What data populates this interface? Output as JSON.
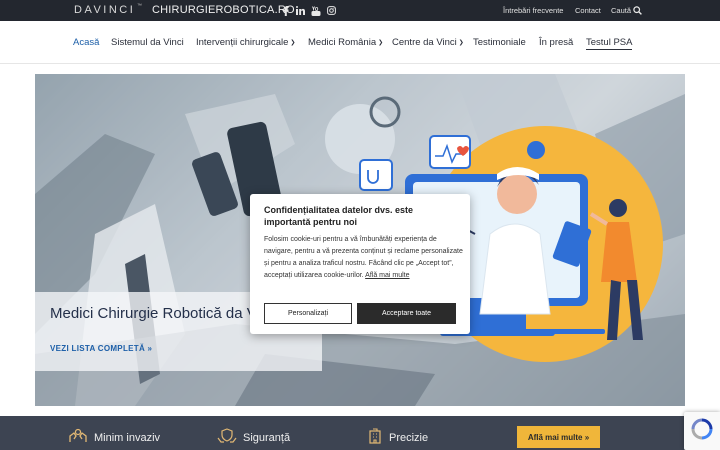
{
  "topbar": {
    "logo": "DAVINCI",
    "logo_tm": "™",
    "site_name": "CHIRURGIEROBOTICA.RO",
    "social_icons": [
      "facebook-icon",
      "linkedin-icon",
      "youtube-icon",
      "instagram-icon"
    ],
    "links": {
      "faq": "Întrebări frecvente",
      "contact": "Contact",
      "search": "Caută"
    }
  },
  "nav": {
    "items": [
      {
        "label": "Acasă",
        "active": true,
        "dropdown": false
      },
      {
        "label": "Sistemul da Vinci",
        "dropdown": false
      },
      {
        "label": "Intervenții chirurgicale",
        "dropdown": true
      },
      {
        "label": "Medici România",
        "dropdown": true
      },
      {
        "label": "Centre da Vinci",
        "dropdown": true
      },
      {
        "label": "Testimoniale",
        "dropdown": false
      },
      {
        "label": "În presă",
        "dropdown": false
      },
      {
        "label": "Testul PSA",
        "dropdown": false,
        "outlined": true
      }
    ]
  },
  "hero": {
    "title": "Medici Chirurgie Robotică da Vinci România",
    "link": "VEZI LISTA COMPLETĂ »"
  },
  "cookie": {
    "title": "Confidențialitatea datelor dvs. este importantă pentru noi",
    "text": "Folosim cookie-uri pentru a vă îmbunătăți experiența de navigare, pentru a vă prezenta conținut și reclame personalizate și pentru a analiza traficul nostru. Făcând clic pe „Accept tot”, acceptați utilizarea cookie-urilor.",
    "more_link": "Află mai multe",
    "customize": "Personalizați",
    "accept_all": "Acceptare toate"
  },
  "features": {
    "items": [
      {
        "label": "Minim invaziv",
        "icon": "hands-icon"
      },
      {
        "label": "Siguranță",
        "icon": "shield-hands-icon"
      },
      {
        "label": "Precizie",
        "icon": "building-icon"
      }
    ],
    "cta": "Află mai multe »"
  },
  "colors": {
    "topbar": "#23272f",
    "accent": "#1d5fa8",
    "cta": "#f0b63a",
    "strip": "#3d4452"
  }
}
